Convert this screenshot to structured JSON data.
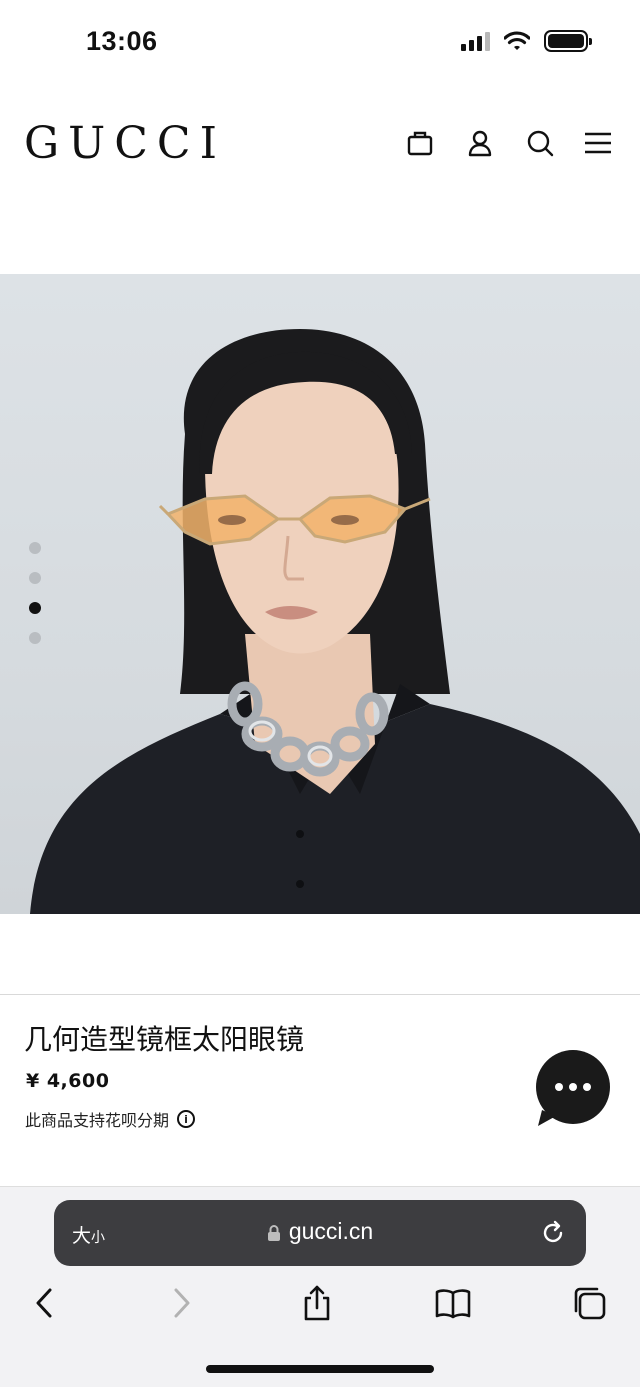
{
  "status_bar": {
    "time": "13:06",
    "icons": [
      "cellular-signal-icon",
      "wifi-icon",
      "battery-icon"
    ]
  },
  "header": {
    "logo": "GUCCI",
    "icons": [
      "shopping-bag-icon",
      "user-icon",
      "search-icon",
      "menu-icon"
    ]
  },
  "hero": {
    "carousel_total": 4,
    "carousel_active_index": 3,
    "background_color": "#dde2e6"
  },
  "product": {
    "name": "几何造型镜框太阳眼镜",
    "price": "¥ 4,600",
    "installment_note": "此商品支持花呗分期",
    "info_icon_glyph": "i"
  },
  "chat": {
    "icon": "chat-bubble-icon",
    "color": "#1a1a1a"
  },
  "browser": {
    "text_size_large": "大",
    "text_size_small": "小",
    "url": "gucci.cn",
    "toolbar": [
      "back-icon",
      "forward-icon",
      "share-icon",
      "bookmarks-icon",
      "tabs-icon"
    ]
  }
}
